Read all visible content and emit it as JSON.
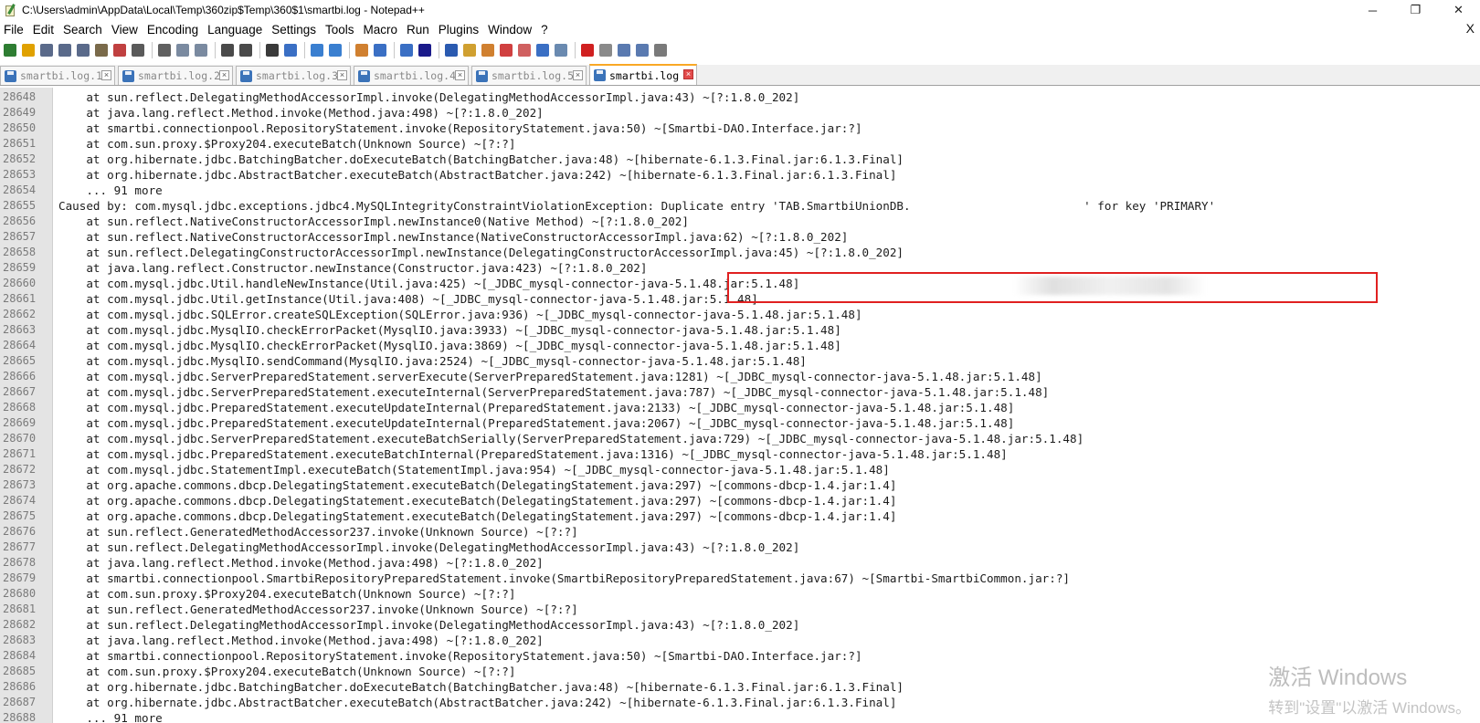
{
  "window": {
    "title": "C:\\Users\\admin\\AppData\\Local\\Temp\\360zip$Temp\\360$1\\smartbi.log - Notepad++",
    "minimize": "─",
    "restore": "❐",
    "close": "✕"
  },
  "menu": {
    "items": [
      "File",
      "Edit",
      "Search",
      "View",
      "Encoding",
      "Language",
      "Settings",
      "Tools",
      "Macro",
      "Run",
      "Plugins",
      "Window",
      "?"
    ],
    "close": "X"
  },
  "toolbar": {
    "colors": [
      "#2e7d32",
      "#e0a100",
      "#5a6a8a",
      "#5a6a8a",
      "#5a6a8a",
      "#7a6a4a",
      "#c04040",
      "#5a5a5a",
      "sep",
      "#606060",
      "#7a8aa0",
      "#7a8aa0",
      "sep",
      "#4a4a4a",
      "#4a4a4a",
      "sep",
      "#3a3a3a",
      "#3a6fc4",
      "sep",
      "#3a7fd0",
      "#3a7fd0",
      "sep",
      "#d08030",
      "#3a6fc4",
      "sep",
      "#3a6fc4",
      "#1a1a8a",
      "sep",
      "#2a5ab0",
      "#d0a030",
      "#d08030",
      "#d04040",
      "#d06060",
      "#3a6fc4",
      "#6a8ab0",
      "sep",
      "#d02020",
      "#8a8a8a",
      "#5a7ab0",
      "#5a7ab0",
      "#7a7a7a"
    ]
  },
  "tabs": [
    {
      "label": "smartbi.log.1",
      "active": false
    },
    {
      "label": "smartbi.log.2",
      "active": false
    },
    {
      "label": "smartbi.log.3",
      "active": false
    },
    {
      "label": "smartbi.log.4",
      "active": false
    },
    {
      "label": "smartbi.log.5",
      "active": false
    },
    {
      "label": "smartbi.log",
      "active": true
    }
  ],
  "editor": {
    "lines": [
      {
        "n": "28648",
        "t": "    at sun.reflect.DelegatingMethodAccessorImpl.invoke(DelegatingMethodAccessorImpl.java:43) ~[?:1.8.0_202]"
      },
      {
        "n": "28649",
        "t": "    at java.lang.reflect.Method.invoke(Method.java:498) ~[?:1.8.0_202]"
      },
      {
        "n": "28650",
        "t": "    at smartbi.connectionpool.RepositoryStatement.invoke(RepositoryStatement.java:50) ~[Smartbi-DAO.Interface.jar:?]"
      },
      {
        "n": "28651",
        "t": "    at com.sun.proxy.$Proxy204.executeBatch(Unknown Source) ~[?:?]"
      },
      {
        "n": "28652",
        "t": "    at org.hibernate.jdbc.BatchingBatcher.doExecuteBatch(BatchingBatcher.java:48) ~[hibernate-6.1.3.Final.jar:6.1.3.Final]"
      },
      {
        "n": "28653",
        "t": "    at org.hibernate.jdbc.AbstractBatcher.executeBatch(AbstractBatcher.java:242) ~[hibernate-6.1.3.Final.jar:6.1.3.Final]"
      },
      {
        "n": "28654",
        "t": "    ... 91 more"
      },
      {
        "n": "28655",
        "t": "Caused by: com.mysql.jdbc.exceptions.jdbc4.MySQLIntegrityConstraintViolationException: Duplicate entry 'TAB.SmartbiUnionDB.                         ' for key 'PRIMARY'"
      },
      {
        "n": "28656",
        "t": "    at sun.reflect.NativeConstructorAccessorImpl.newInstance0(Native Method) ~[?:1.8.0_202]"
      },
      {
        "n": "28657",
        "t": "    at sun.reflect.NativeConstructorAccessorImpl.newInstance(NativeConstructorAccessorImpl.java:62) ~[?:1.8.0_202]"
      },
      {
        "n": "28658",
        "t": "    at sun.reflect.DelegatingConstructorAccessorImpl.newInstance(DelegatingConstructorAccessorImpl.java:45) ~[?:1.8.0_202]"
      },
      {
        "n": "28659",
        "t": "    at java.lang.reflect.Constructor.newInstance(Constructor.java:423) ~[?:1.8.0_202]"
      },
      {
        "n": "28660",
        "t": "    at com.mysql.jdbc.Util.handleNewInstance(Util.java:425) ~[_JDBC_mysql-connector-java-5.1.48.jar:5.1.48]"
      },
      {
        "n": "28661",
        "t": "    at com.mysql.jdbc.Util.getInstance(Util.java:408) ~[_JDBC_mysql-connector-java-5.1.48.jar:5.1.48]"
      },
      {
        "n": "28662",
        "t": "    at com.mysql.jdbc.SQLError.createSQLException(SQLError.java:936) ~[_JDBC_mysql-connector-java-5.1.48.jar:5.1.48]"
      },
      {
        "n": "28663",
        "t": "    at com.mysql.jdbc.MysqlIO.checkErrorPacket(MysqlIO.java:3933) ~[_JDBC_mysql-connector-java-5.1.48.jar:5.1.48]"
      },
      {
        "n": "28664",
        "t": "    at com.mysql.jdbc.MysqlIO.checkErrorPacket(MysqlIO.java:3869) ~[_JDBC_mysql-connector-java-5.1.48.jar:5.1.48]"
      },
      {
        "n": "28665",
        "t": "    at com.mysql.jdbc.MysqlIO.sendCommand(MysqlIO.java:2524) ~[_JDBC_mysql-connector-java-5.1.48.jar:5.1.48]"
      },
      {
        "n": "28666",
        "t": "    at com.mysql.jdbc.ServerPreparedStatement.serverExecute(ServerPreparedStatement.java:1281) ~[_JDBC_mysql-connector-java-5.1.48.jar:5.1.48]"
      },
      {
        "n": "28667",
        "t": "    at com.mysql.jdbc.ServerPreparedStatement.executeInternal(ServerPreparedStatement.java:787) ~[_JDBC_mysql-connector-java-5.1.48.jar:5.1.48]"
      },
      {
        "n": "28668",
        "t": "    at com.mysql.jdbc.PreparedStatement.executeUpdateInternal(PreparedStatement.java:2133) ~[_JDBC_mysql-connector-java-5.1.48.jar:5.1.48]"
      },
      {
        "n": "28669",
        "t": "    at com.mysql.jdbc.PreparedStatement.executeUpdateInternal(PreparedStatement.java:2067) ~[_JDBC_mysql-connector-java-5.1.48.jar:5.1.48]"
      },
      {
        "n": "28670",
        "t": "    at com.mysql.jdbc.ServerPreparedStatement.executeBatchSerially(ServerPreparedStatement.java:729) ~[_JDBC_mysql-connector-java-5.1.48.jar:5.1.48]"
      },
      {
        "n": "28671",
        "t": "    at com.mysql.jdbc.PreparedStatement.executeBatchInternal(PreparedStatement.java:1316) ~[_JDBC_mysql-connector-java-5.1.48.jar:5.1.48]"
      },
      {
        "n": "28672",
        "t": "    at com.mysql.jdbc.StatementImpl.executeBatch(StatementImpl.java:954) ~[_JDBC_mysql-connector-java-5.1.48.jar:5.1.48]"
      },
      {
        "n": "28673",
        "t": "    at org.apache.commons.dbcp.DelegatingStatement.executeBatch(DelegatingStatement.java:297) ~[commons-dbcp-1.4.jar:1.4]"
      },
      {
        "n": "28674",
        "t": "    at org.apache.commons.dbcp.DelegatingStatement.executeBatch(DelegatingStatement.java:297) ~[commons-dbcp-1.4.jar:1.4]"
      },
      {
        "n": "28675",
        "t": "    at org.apache.commons.dbcp.DelegatingStatement.executeBatch(DelegatingStatement.java:297) ~[commons-dbcp-1.4.jar:1.4]"
      },
      {
        "n": "28676",
        "t": "    at sun.reflect.GeneratedMethodAccessor237.invoke(Unknown Source) ~[?:?]"
      },
      {
        "n": "28677",
        "t": "    at sun.reflect.DelegatingMethodAccessorImpl.invoke(DelegatingMethodAccessorImpl.java:43) ~[?:1.8.0_202]"
      },
      {
        "n": "28678",
        "t": "    at java.lang.reflect.Method.invoke(Method.java:498) ~[?:1.8.0_202]"
      },
      {
        "n": "28679",
        "t": "    at smartbi.connectionpool.SmartbiRepositoryPreparedStatement.invoke(SmartbiRepositoryPreparedStatement.java:67) ~[Smartbi-SmartbiCommon.jar:?]"
      },
      {
        "n": "28680",
        "t": "    at com.sun.proxy.$Proxy204.executeBatch(Unknown Source) ~[?:?]"
      },
      {
        "n": "28681",
        "t": "    at sun.reflect.GeneratedMethodAccessor237.invoke(Unknown Source) ~[?:?]"
      },
      {
        "n": "28682",
        "t": "    at sun.reflect.DelegatingMethodAccessorImpl.invoke(DelegatingMethodAccessorImpl.java:43) ~[?:1.8.0_202]"
      },
      {
        "n": "28683",
        "t": "    at java.lang.reflect.Method.invoke(Method.java:498) ~[?:1.8.0_202]"
      },
      {
        "n": "28684",
        "t": "    at smartbi.connectionpool.RepositoryStatement.invoke(RepositoryStatement.java:50) ~[Smartbi-DAO.Interface.jar:?]"
      },
      {
        "n": "28685",
        "t": "    at com.sun.proxy.$Proxy204.executeBatch(Unknown Source) ~[?:?]"
      },
      {
        "n": "28686",
        "t": "    at org.hibernate.jdbc.BatchingBatcher.doExecuteBatch(BatchingBatcher.java:48) ~[hibernate-6.1.3.Final.jar:6.1.3.Final]"
      },
      {
        "n": "28687",
        "t": "    at org.hibernate.jdbc.AbstractBatcher.executeBatch(AbstractBatcher.java:242) ~[hibernate-6.1.3.Final.jar:6.1.3.Final]"
      },
      {
        "n": "28688",
        "t": "    ... 91 more"
      }
    ]
  },
  "watermark": {
    "line1": "激活 Windows",
    "line2": "转到\"设置\"以激活 Windows。"
  },
  "colors": {
    "highlight_box": "#e02020",
    "active_tab_accent": "#f9a825"
  }
}
